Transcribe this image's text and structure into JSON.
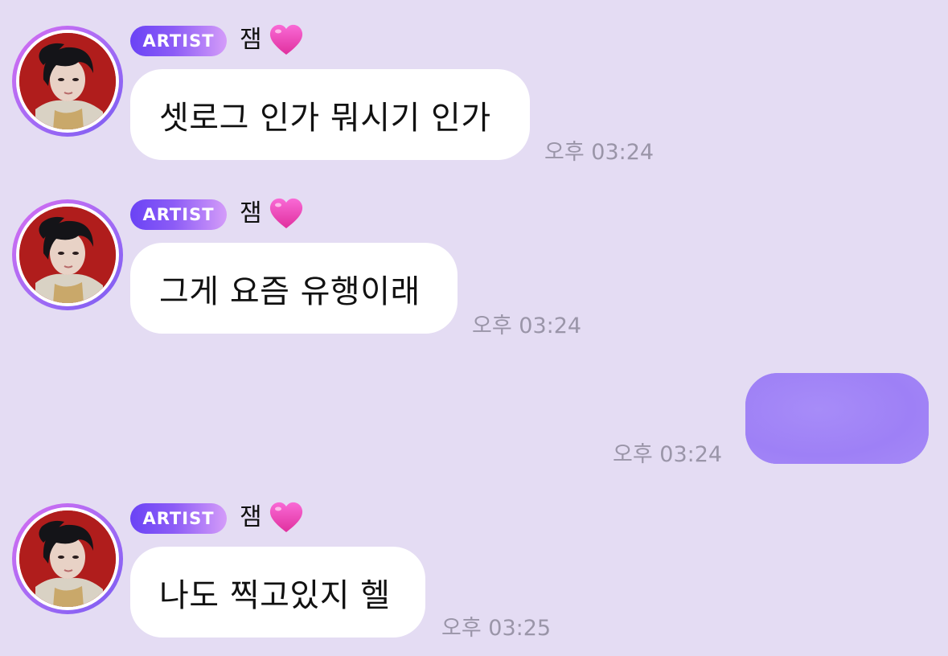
{
  "messages": [
    {
      "badge": "ARTIST",
      "sender": "잼",
      "text": "셋로그 인가 뭐시기 인가",
      "time": "오후 03:24"
    },
    {
      "badge": "ARTIST",
      "sender": "잼",
      "text": "그게 요즘 유행이래",
      "time": "오후 03:24"
    },
    {
      "own": true,
      "text": "",
      "time": "오후 03:24"
    },
    {
      "badge": "ARTIST",
      "sender": "잼",
      "text": "나도 찍고있지 헬",
      "time": "오후 03:25"
    }
  ],
  "colors": {
    "background": "#e4dcf3",
    "artist_badge_start": "#6a43f5",
    "artist_badge_end": "#d49cf9",
    "avatar_ring": "#a66cf5",
    "own_bubble": "#a186f7",
    "timestamp": "#9a95a8"
  },
  "icons": {
    "sender_suffix": "heart-icon",
    "avatar": "profile-photo"
  }
}
